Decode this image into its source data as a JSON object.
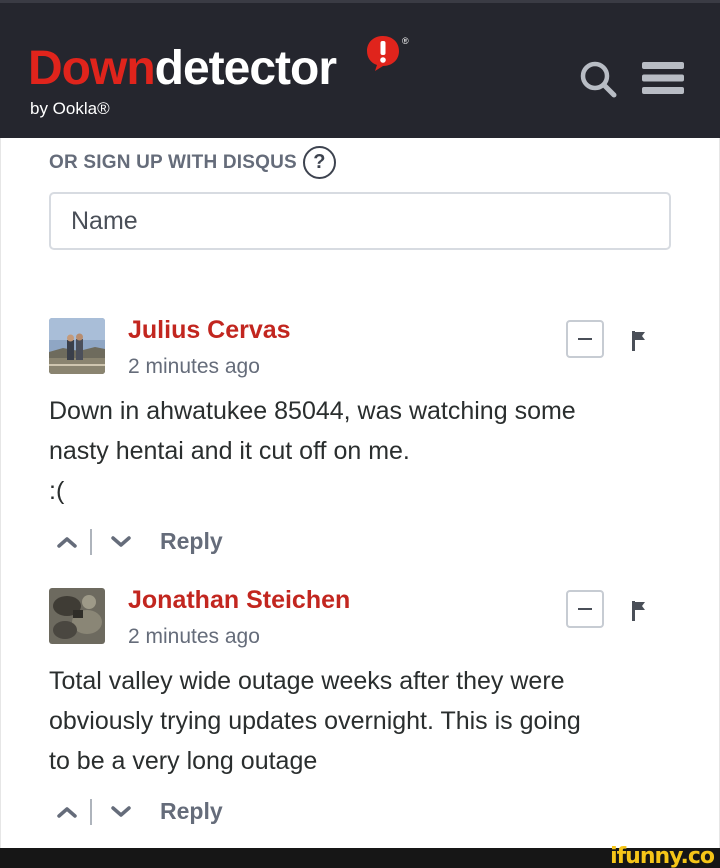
{
  "header": {
    "logo_down": "Down",
    "logo_detector": "detector",
    "logo_registered": "®",
    "byline": "by Ookla®",
    "search_icon": "search-icon",
    "menu_icon": "hamburger-menu-icon",
    "background_color": "#25262e",
    "brand_red": "#e0241c"
  },
  "signup": {
    "label": "OR SIGN UP WITH DISQUS",
    "help_glyph": "?"
  },
  "name_field": {
    "placeholder": "Name",
    "value": ""
  },
  "comments": [
    {
      "author": "Julius Cervas",
      "timestamp": "2 minutes ago",
      "body_lines": [
        "Down in ahwatukee 85044, was watching some",
        "nasty hentai and it cut off on me.",
        ":("
      ],
      "reply_label": "Reply"
    },
    {
      "author": "Jonathan Steichen",
      "timestamp": "2 minutes ago",
      "body_lines": [
        "Total valley wide outage weeks after they were",
        "obviously trying updates overnight. This is going",
        "to be a very long outage"
      ],
      "reply_label": "Reply"
    }
  ],
  "colors": {
    "author_red": "#c2261f",
    "meta_gray": "#656c7a",
    "text_dark": "#2a2e2e"
  },
  "watermark": "ifunny.co"
}
